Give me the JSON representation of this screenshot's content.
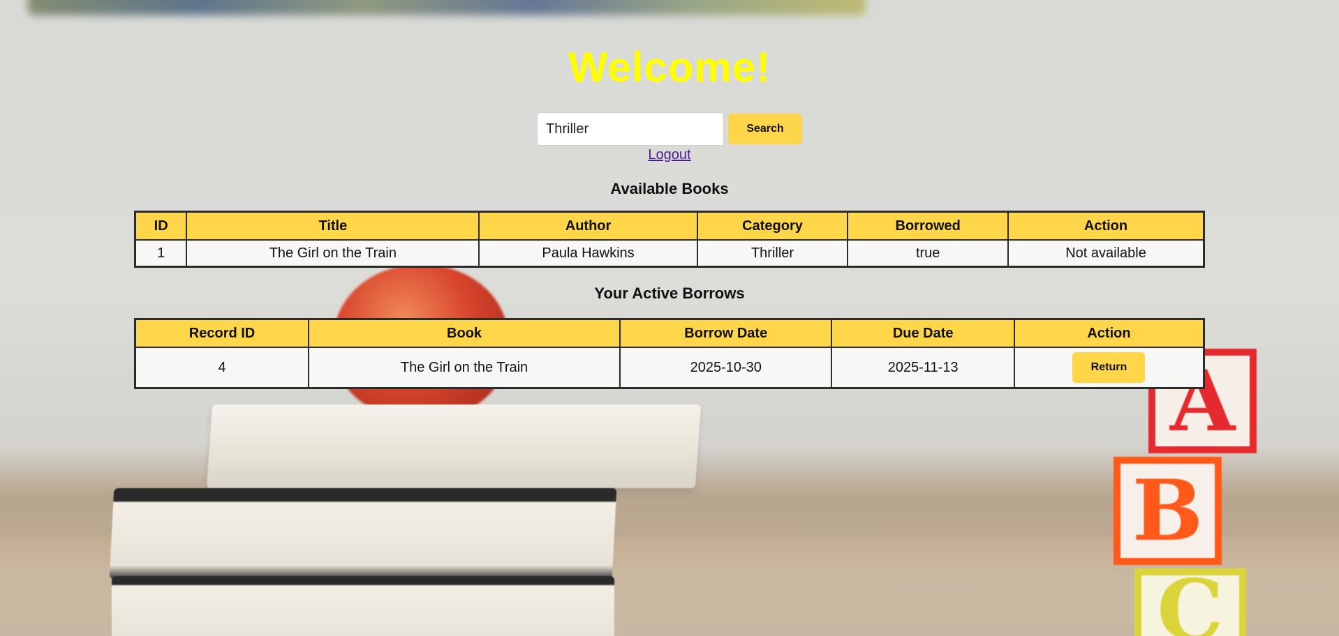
{
  "header": {
    "title": "Welcome!"
  },
  "search": {
    "value": "Thriller",
    "button_label": "Search"
  },
  "nav": {
    "logout_label": "Logout"
  },
  "available_books": {
    "title": "Available Books",
    "columns": [
      "ID",
      "Title",
      "Author",
      "Category",
      "Borrowed",
      "Action"
    ],
    "rows": [
      {
        "id": "1",
        "title": "The Girl on the Train",
        "author": "Paula Hawkins",
        "category": "Thriller",
        "borrowed": "true",
        "action": "Not available"
      }
    ]
  },
  "active_borrows": {
    "title": "Your Active Borrows",
    "columns": [
      "Record ID",
      "Book",
      "Borrow Date",
      "Due Date",
      "Action"
    ],
    "rows": [
      {
        "record_id": "4",
        "book": "The Girl on the Train",
        "borrow_date": "2025-10-30",
        "due_date": "2025-11-13",
        "action_label": "Return"
      }
    ]
  },
  "colors": {
    "title": "#ffff00",
    "accent": "#ffd54a",
    "link": "#4b1b8f"
  },
  "background": {
    "blocks": [
      "A",
      "B",
      "C"
    ]
  }
}
